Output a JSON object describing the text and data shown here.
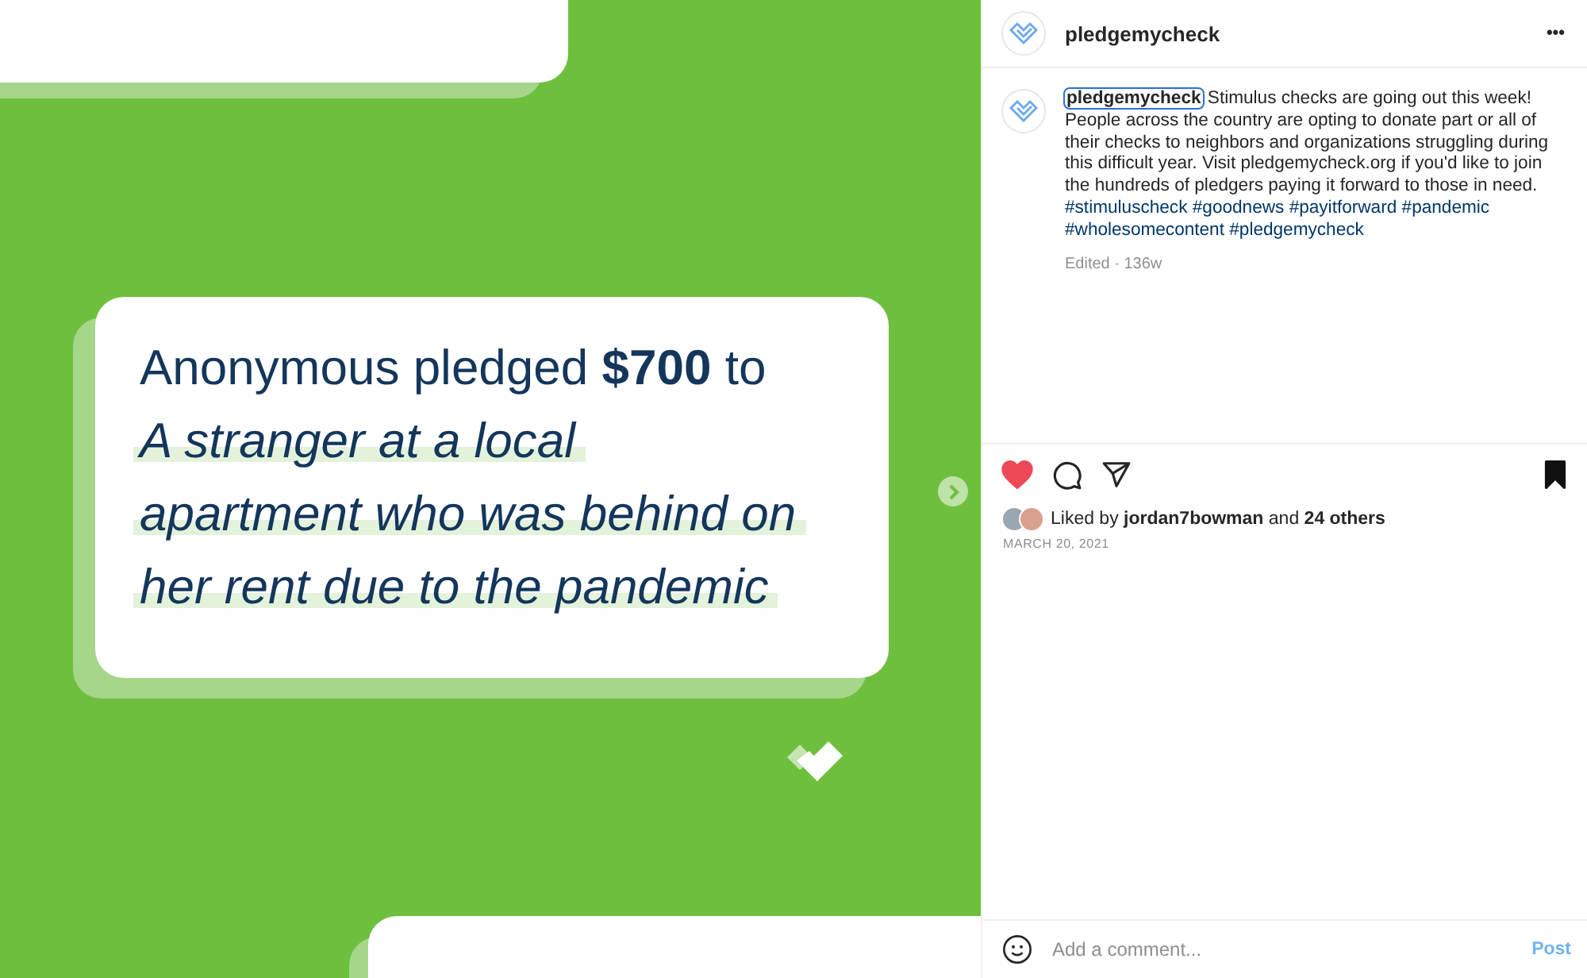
{
  "post_image": {
    "pledge_text": "Anonymous pledged **$700** to",
    "recipient_lines": [
      "A stranger at a local",
      "apartment who was behind on",
      "her rent due to the pandemic"
    ]
  },
  "header": {
    "username": "pledgemycheck",
    "more": "•••"
  },
  "caption": {
    "username": "pledgemycheck",
    "focused": true,
    "text": "Stimulus checks are going out this week! People across the country are opting to donate part or all of their checks to neighbors and organizations struggling during this difficult year. Visit pledgemycheck.org if you'd like to join the hundreds of pledgers paying it forward to those in need.",
    "hashtags": [
      "#stimuluscheck",
      "#goodnews",
      "#payitforward",
      "#pandemic",
      "#wholesomecontent",
      "#pledgemycheck"
    ],
    "meta": "Edited · 136w"
  },
  "actions": {
    "liked": true,
    "saved": true
  },
  "likes": {
    "text": "Liked by **jordan7bowman** and **24 others**"
  },
  "date": "MARCH 20, 2021",
  "comment": {
    "placeholder": "Add a comment...",
    "post_label": "Post",
    "post_disabled": true
  }
}
